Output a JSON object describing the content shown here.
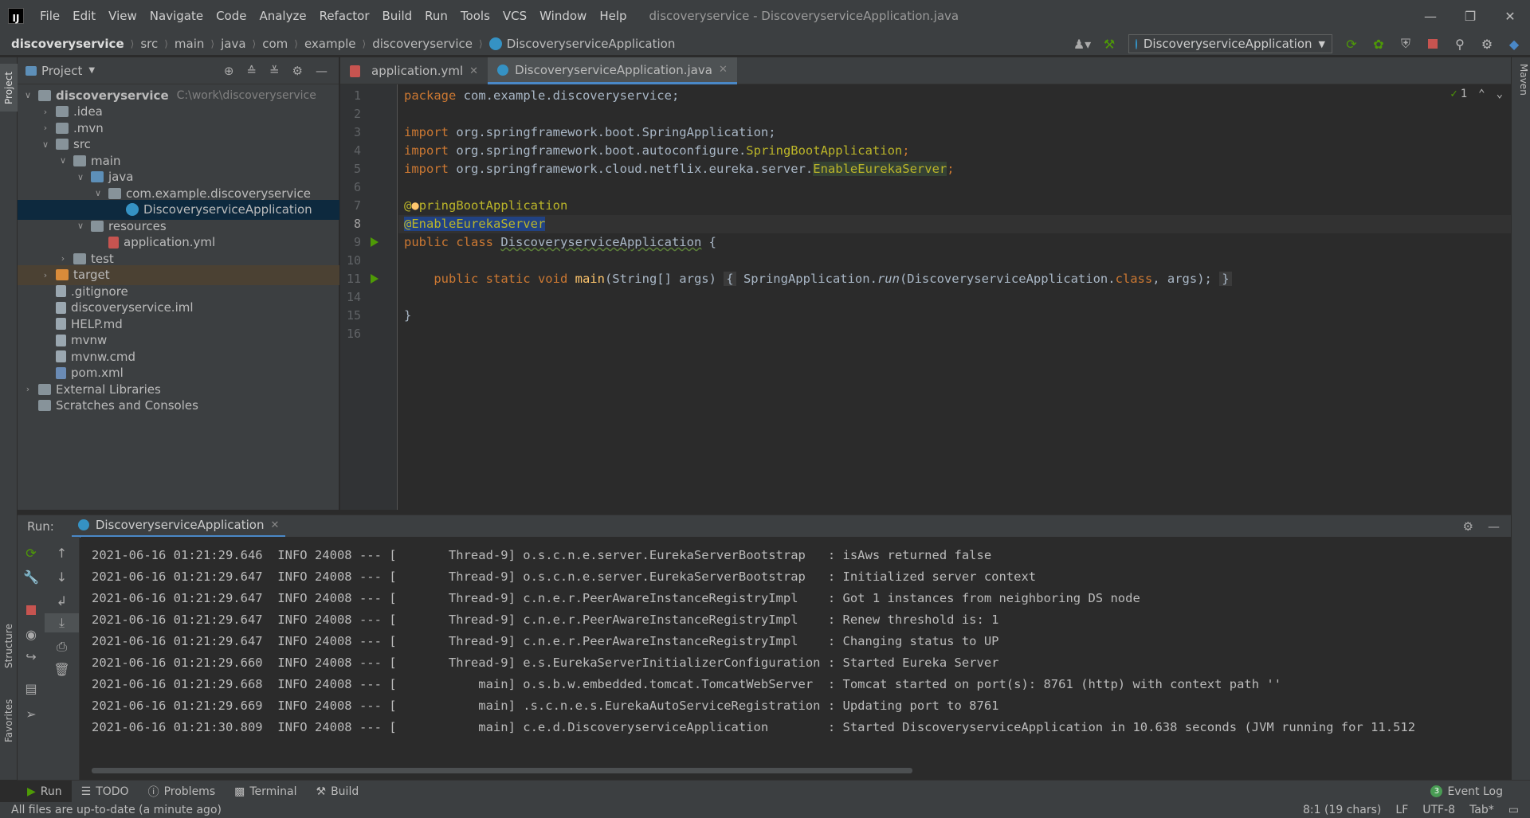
{
  "app": {
    "logo": "IJ",
    "window_title": "discoveryservice - DiscoveryserviceApplication.java"
  },
  "menu": [
    "File",
    "Edit",
    "View",
    "Navigate",
    "Code",
    "Analyze",
    "Refactor",
    "Build",
    "Run",
    "Tools",
    "VCS",
    "Window",
    "Help"
  ],
  "breadcrumb": [
    "discoveryservice",
    "src",
    "main",
    "java",
    "com",
    "example",
    "discoveryservice",
    "DiscoveryserviceApplication"
  ],
  "run_config": {
    "label": "DiscoveryserviceApplication"
  },
  "side_tabs": {
    "project": "Project",
    "structure": "Structure",
    "favorites": "Favorites",
    "maven": "Maven"
  },
  "project_panel": {
    "title": "Project",
    "tree": [
      {
        "label": "discoveryservice",
        "hint": "C:\\work\\discoveryservice",
        "level": 0,
        "chevron": "down",
        "icon": "folder-icon"
      },
      {
        "label": ".idea",
        "level": 1,
        "chevron": "right",
        "icon": "folder-icon"
      },
      {
        "label": ".mvn",
        "level": 1,
        "chevron": "right",
        "icon": "folder-icon"
      },
      {
        "label": "src",
        "level": 1,
        "chevron": "down",
        "icon": "folder-icon"
      },
      {
        "label": "main",
        "level": 2,
        "chevron": "down",
        "icon": "folder-icon"
      },
      {
        "label": "java",
        "level": 3,
        "chevron": "down",
        "icon": "source-folder-icon"
      },
      {
        "label": "com.example.discoveryservice",
        "level": 4,
        "chevron": "down",
        "icon": "package-icon"
      },
      {
        "label": "DiscoveryserviceApplication",
        "level": 5,
        "chevron": "",
        "icon": "java-class-icon",
        "selected": true
      },
      {
        "label": "resources",
        "level": 3,
        "chevron": "down",
        "icon": "resources-folder-icon"
      },
      {
        "label": "application.yml",
        "level": 4,
        "chevron": "",
        "icon": "yml-file-icon"
      },
      {
        "label": "test",
        "level": 2,
        "chevron": "right",
        "icon": "folder-icon"
      },
      {
        "label": "target",
        "level": 1,
        "chevron": "right",
        "icon": "excluded-folder-icon",
        "excluded": true
      },
      {
        "label": ".gitignore",
        "level": 1,
        "chevron": "",
        "icon": "file-icon"
      },
      {
        "label": "discoveryservice.iml",
        "level": 1,
        "chevron": "",
        "icon": "iml-file-icon"
      },
      {
        "label": "HELP.md",
        "level": 1,
        "chevron": "",
        "icon": "markdown-file-icon"
      },
      {
        "label": "mvnw",
        "level": 1,
        "chevron": "",
        "icon": "script-file-icon"
      },
      {
        "label": "mvnw.cmd",
        "level": 1,
        "chevron": "",
        "icon": "script-file-icon"
      },
      {
        "label": "pom.xml",
        "level": 1,
        "chevron": "",
        "icon": "maven-file-icon"
      },
      {
        "label": "External Libraries",
        "level": 0,
        "chevron": "right",
        "icon": "libraries-icon"
      },
      {
        "label": "Scratches and Consoles",
        "level": 0,
        "chevron": "",
        "icon": "scratches-icon"
      }
    ]
  },
  "editor_tabs": [
    {
      "label": "application.yml",
      "active": false
    },
    {
      "label": "DiscoveryserviceApplication.java",
      "active": true
    }
  ],
  "inspection": {
    "count": "1"
  },
  "code": {
    "line_numbers": [
      "1",
      "2",
      "3",
      "4",
      "5",
      "6",
      "7",
      "8",
      "9",
      "10",
      "11",
      "14",
      "15",
      "16"
    ],
    "l1_kw": "package",
    "l1_rest": " com.example.discoveryservice;",
    "l3_kw": "import",
    "l3_rest": " org.springframework.boot.SpringApplication;",
    "l4_kw": "import",
    "l4_rest": " org.springframework.boot.autoconfigure.",
    "l4_ann": "SpringBootApplication",
    "l4_end": ";",
    "l5_kw": "import",
    "l5_rest": " org.springframework.cloud.netflix.eureka.server.",
    "l5_ann": "EnableEurekaServer",
    "l5_end": ";",
    "l7_at": "@",
    "l7_ann": "pringBootApplication",
    "l8_ann": "@EnableEurekaServer",
    "l9_kw": "public class ",
    "l9_name": "DiscoveryserviceApplication",
    "l9_rest": " {",
    "l11_kw": "public static void ",
    "l11_fn": "main",
    "l11_args": "(String[] args) ",
    "l11_open": "{",
    "l11_mid": " SpringApplication.",
    "l11_run": "run",
    "l11_call": "(DiscoveryserviceApplication.",
    "l11_class": "class",
    "l11_tail": ", args);",
    "l11_close": "}",
    "l15": "}"
  },
  "run_panel": {
    "label": "Run:",
    "tab": "DiscoveryserviceApplication"
  },
  "console": [
    "2021-06-16 01:21:29.646  INFO 24008 --- [       Thread-9] o.s.c.n.e.server.EurekaServerBootstrap   : isAws returned false",
    "2021-06-16 01:21:29.647  INFO 24008 --- [       Thread-9] o.s.c.n.e.server.EurekaServerBootstrap   : Initialized server context",
    "2021-06-16 01:21:29.647  INFO 24008 --- [       Thread-9] c.n.e.r.PeerAwareInstanceRegistryImpl    : Got 1 instances from neighboring DS node",
    "2021-06-16 01:21:29.647  INFO 24008 --- [       Thread-9] c.n.e.r.PeerAwareInstanceRegistryImpl    : Renew threshold is: 1",
    "2021-06-16 01:21:29.647  INFO 24008 --- [       Thread-9] c.n.e.r.PeerAwareInstanceRegistryImpl    : Changing status to UP",
    "2021-06-16 01:21:29.660  INFO 24008 --- [       Thread-9] e.s.EurekaServerInitializerConfiguration : Started Eureka Server",
    "2021-06-16 01:21:29.668  INFO 24008 --- [           main] o.s.b.w.embedded.tomcat.TomcatWebServer  : Tomcat started on port(s): 8761 (http) with context path ''",
    "2021-06-16 01:21:29.669  INFO 24008 --- [           main] .s.c.n.e.s.EurekaAutoServiceRegistration : Updating port to 8761",
    "2021-06-16 01:21:30.809  INFO 24008 --- [           main] c.e.d.DiscoveryserviceApplication        : Started DiscoveryserviceApplication in 10.638 seconds (JVM running for 11.512"
  ],
  "bottom_tools": {
    "run": "Run",
    "todo": "TODO",
    "problems": "Problems",
    "terminal": "Terminal",
    "build": "Build",
    "event_log": "Event Log",
    "event_count": "3"
  },
  "status": {
    "message": "All files are up-to-date (a minute ago)",
    "position": "8:1 (19 chars)",
    "line_sep": "LF",
    "encoding": "UTF-8",
    "indent": "Tab*"
  }
}
